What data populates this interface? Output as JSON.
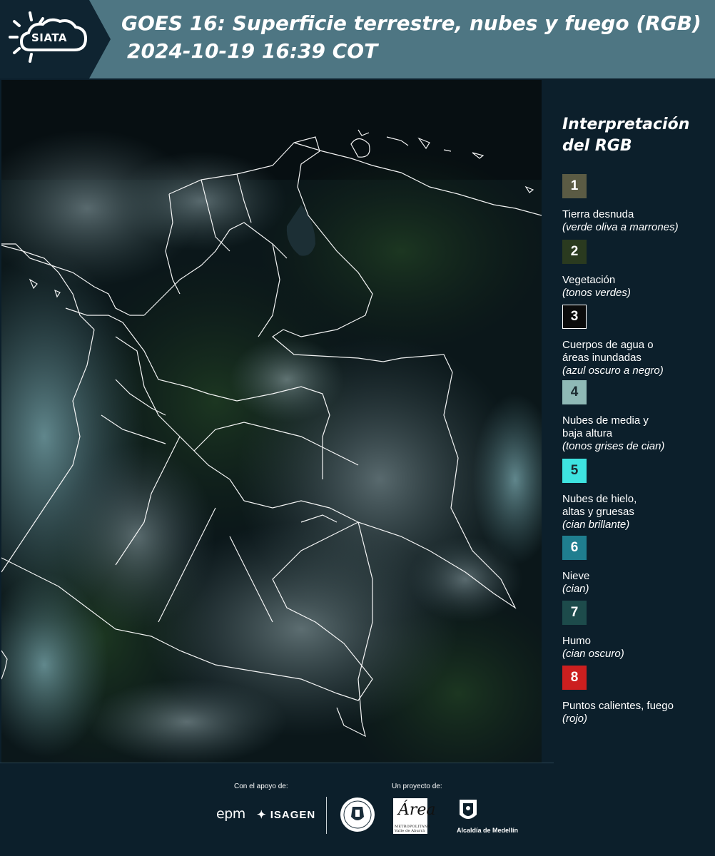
{
  "header": {
    "logo_text": "SIATA",
    "title_line1": "GOES 16: Superficie terrestre, nubes y fuego (RGB)",
    "title_line2": "2024-10-19 16:39 COT"
  },
  "legend": {
    "title_line1": "Interpretación",
    "title_line2": "del RGB",
    "items": [
      {
        "number": "1",
        "color": "#5b5b44",
        "label": "Tierra desnuda",
        "note": "(verde oliva a marrones)"
      },
      {
        "number": "2",
        "color": "#2a3a1f",
        "label": "Vegetación",
        "note": "(tonos verdes)"
      },
      {
        "number": "3",
        "color": "#0b0b0b",
        "label": "Cuerpos de agua o áreas inundadas",
        "note": "(azul oscuro a negro)"
      },
      {
        "number": "4",
        "color": "#8fb9b6",
        "label": "Nubes de media y baja altura",
        "note": "(tonos grises de cian)"
      },
      {
        "number": "5",
        "color": "#3ee3e0",
        "label": "Nubes de hielo, altas y gruesas",
        "note": "(cian brillante)"
      },
      {
        "number": "6",
        "color": "#1f7e8f",
        "label": "Nieve",
        "note": "(cian)"
      },
      {
        "number": "7",
        "color": "#1d4b4b",
        "label": "Humo",
        "note": "(cian oscuro)"
      },
      {
        "number": "8",
        "color": "#cc1f1f",
        "label": "Puntos calientes, fuego",
        "note": "(rojo)"
      }
    ]
  },
  "footer": {
    "support_label": "Con el apoyo de:",
    "project_label": "Un proyecto de:",
    "epm_text": "epm",
    "isagen_text": "ISAGEN",
    "area_text": "Área",
    "area_subtext": "METROPOLITANA Valle de Aburrá",
    "alcaldia_text": "Alcaldía de Medellín"
  },
  "colors": {
    "header_bg": "#4e7683",
    "logo_bg": "#0f2431",
    "page_bg": "#0c1f2b"
  }
}
